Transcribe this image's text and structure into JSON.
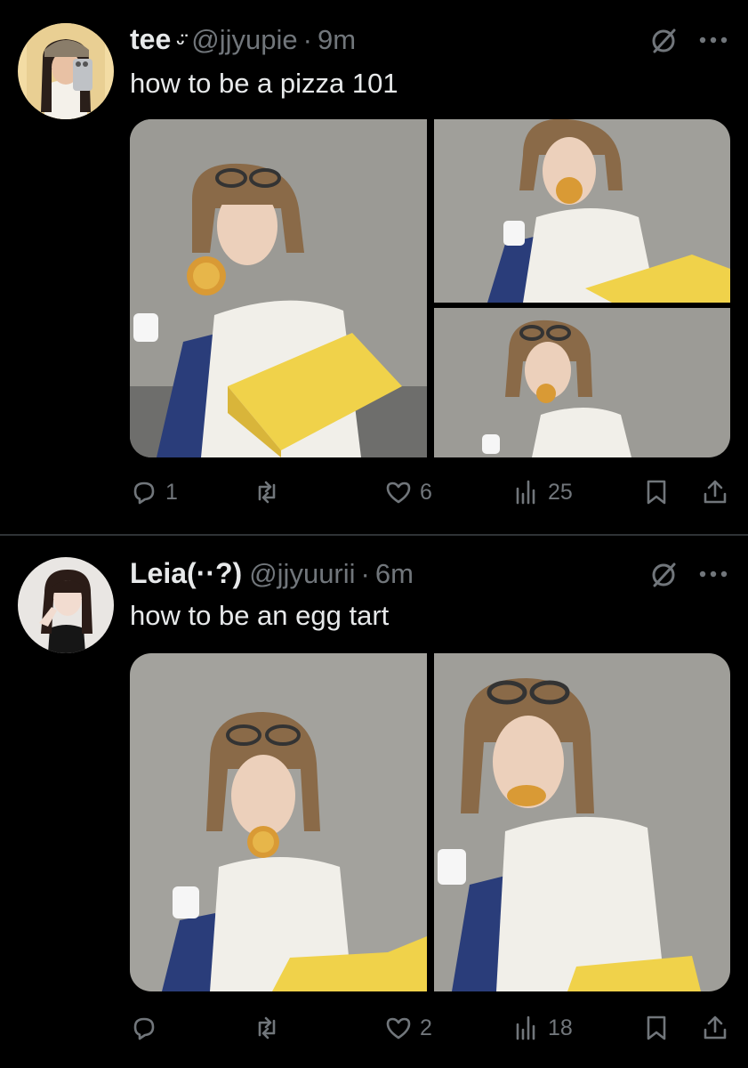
{
  "tweets": [
    {
      "name": "tee",
      "name_suffix": "ᵕ̈",
      "handle": "@jjyupie",
      "dot": "·",
      "time": "9m",
      "text": "how to be a pizza 101",
      "actions": {
        "replies": "1",
        "reposts": "",
        "likes": "6",
        "views": "25"
      }
    },
    {
      "name": "Leia(··?)",
      "name_suffix": "",
      "handle": "@jjyuurii",
      "dot": "·",
      "time": "6m",
      "text": "how to be an egg tart",
      "actions": {
        "replies": "",
        "reposts": "",
        "likes": "2",
        "views": "18"
      }
    }
  ],
  "icons": [
    "grok-icon",
    "more-icon",
    "reply-icon",
    "repost-icon",
    "like-icon",
    "views-icon",
    "bookmark-icon",
    "share-icon"
  ],
  "colors": {
    "background": "#000000",
    "text": "#e7e9ea",
    "secondary": "#71767b",
    "divider": "#2f3336"
  }
}
